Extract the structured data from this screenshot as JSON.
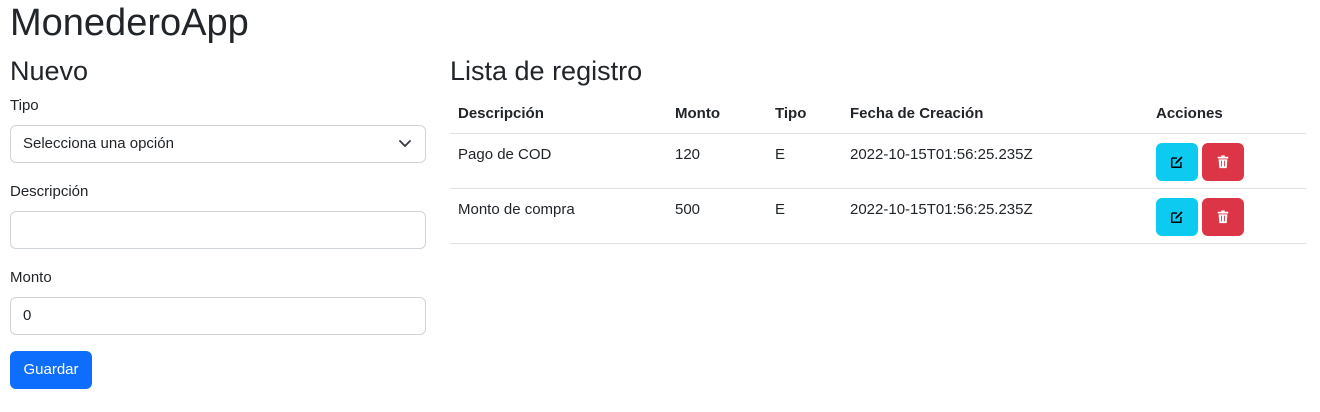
{
  "app": {
    "title": "MonederoApp"
  },
  "form": {
    "title": "Nuevo",
    "tipo_label": "Tipo",
    "tipo_selected": "Selecciona una opción",
    "descripcion_label": "Descripción",
    "descripcion_value": "",
    "monto_label": "Monto",
    "monto_value": "0",
    "save_label": "Guardar"
  },
  "list": {
    "title": "Lista de registro",
    "columns": [
      "Descripción",
      "Monto",
      "Tipo",
      "Fecha de Creación",
      "Acciones"
    ],
    "rows": [
      {
        "descripcion": "Pago de COD",
        "monto": "120",
        "tipo": "E",
        "fecha": "2022-10-15T01:56:25.235Z"
      },
      {
        "descripcion": "Monto de compra",
        "monto": "500",
        "tipo": "E",
        "fecha": "2022-10-15T01:56:25.235Z"
      }
    ]
  },
  "icons": {
    "edit": "edit-icon",
    "delete": "trash-icon",
    "dropdown": "chevron-down-icon"
  },
  "colors": {
    "primary": "#0d6efd",
    "info": "#0dcaf0",
    "danger": "#dc3545"
  }
}
